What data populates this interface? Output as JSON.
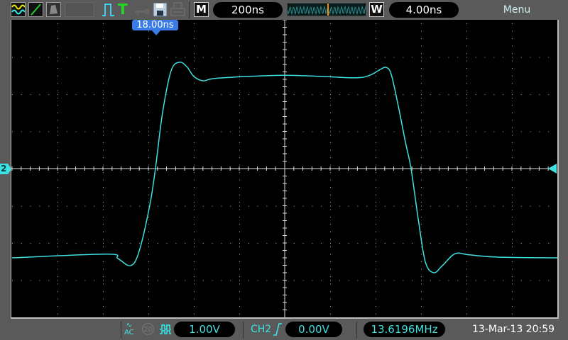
{
  "toolbar": {
    "timebase_mode_label": "M",
    "timebase": "200ns",
    "window_mode_label": "W",
    "window_timebase": "4.00ns",
    "menu_label": "Menu",
    "trigger_status_label": "T",
    "icons": [
      "dual-wave-icon",
      "xy-icon",
      "persist-icon",
      "run-pulse-icon",
      "trigger-icon",
      "key-icon",
      "save-icon",
      "print-icon"
    ]
  },
  "trigger_position_label": "18.00ns",
  "channel_marker": "2",
  "bottom_bar": {
    "coupling": "AC",
    "bw_limit": "20",
    "ch_scale": "1.00V",
    "trigger_source": "CH2",
    "trigger_level": "0.00V",
    "frequency": "13.6196MHz",
    "datetime": "13-Mar-13 20:59"
  },
  "colors": {
    "trace": "#3fe0e0",
    "accent_blue": "#3a7be8",
    "trigger_green": "#22dd22",
    "window_marker": "#ff8800"
  },
  "waveform": {
    "channel": "CH2",
    "time_per_div_ns": 200,
    "volts_per_div": 1.0,
    "t_ns": [
      -1200,
      -781,
      -734,
      -678,
      -641,
      -594,
      -569,
      -538,
      -500,
      -463,
      -431,
      -400,
      -359,
      -313,
      -156,
      0,
      156,
      313,
      375,
      422,
      447,
      469,
      500,
      531,
      556,
      588,
      619,
      656,
      694,
      750,
      813,
      938,
      1200
    ],
    "v": [
      -2.4,
      -2.3,
      -2.42,
      -2.61,
      -2.23,
      -0.99,
      0,
      1.49,
      2.63,
      2.86,
      2.74,
      2.48,
      2.36,
      2.42,
      2.48,
      2.51,
      2.48,
      2.44,
      2.51,
      2.67,
      2.72,
      2.53,
      1.68,
      0.72,
      0,
      -1.37,
      -2.51,
      -2.8,
      -2.61,
      -2.29,
      -2.32,
      -2.38,
      -2.4
    ]
  }
}
